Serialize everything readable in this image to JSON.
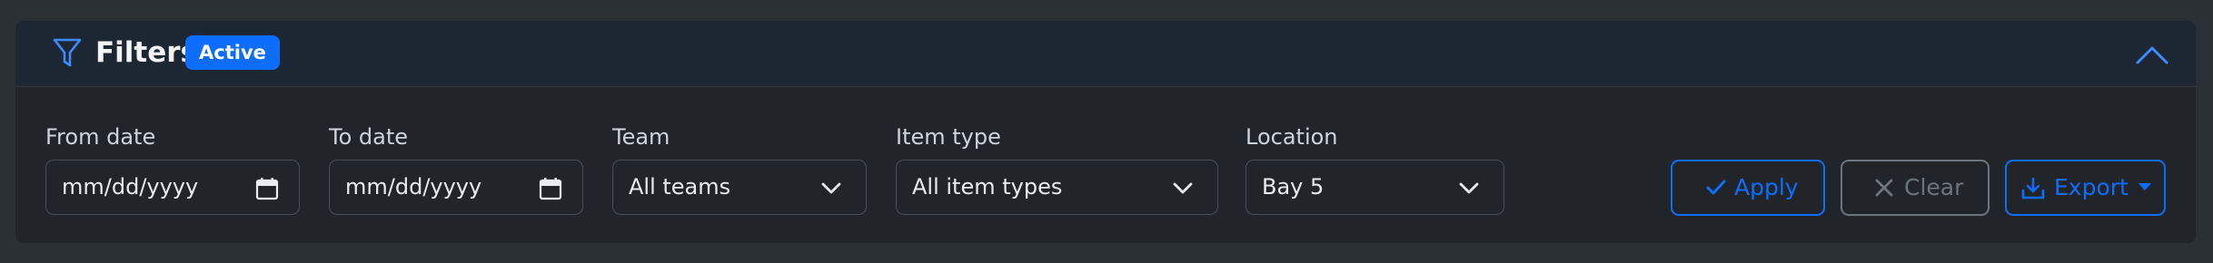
{
  "header": {
    "title": "Filters",
    "badge": "Active"
  },
  "filters": {
    "from_date": {
      "label": "From date",
      "placeholder": "mm/dd/yyyy"
    },
    "to_date": {
      "label": "To date",
      "placeholder": "mm/dd/yyyy"
    },
    "team": {
      "label": "Team",
      "value": "All teams"
    },
    "item_type": {
      "label": "Item type",
      "value": "All item types"
    },
    "location": {
      "label": "Location",
      "value": "Bay 5"
    }
  },
  "actions": {
    "apply": "Apply",
    "clear": "Clear",
    "export": "Export"
  },
  "icons": {
    "filter": "funnel-icon",
    "collapse": "chevron-up-icon",
    "calendar": "calendar-icon",
    "dropdown": "chevron-down-icon",
    "apply": "check-icon",
    "clear": "x-icon",
    "export": "download-icon"
  },
  "colors": {
    "accent": "#0d6efd",
    "muted": "#6c757d",
    "background": "#2b3035",
    "card": "#212529",
    "header": "#1d2733"
  }
}
